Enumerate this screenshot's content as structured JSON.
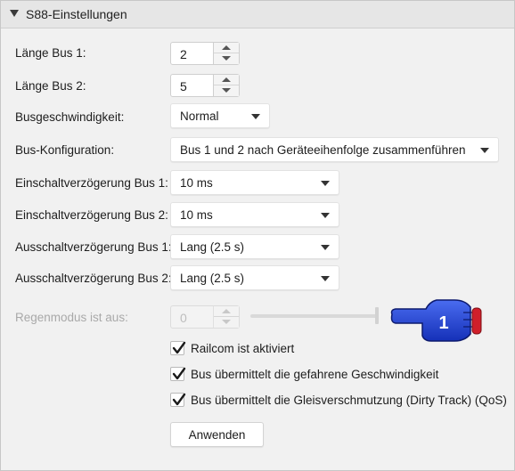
{
  "panel": {
    "title": "S88-Einstellungen"
  },
  "rows": {
    "laenge_bus1": {
      "label": "Länge Bus 1:",
      "value": "2"
    },
    "laenge_bus2": {
      "label": "Länge Bus 2:",
      "value": "5"
    },
    "busgeschwindigkeit": {
      "label": "Busgeschwindigkeit:",
      "value": "Normal"
    },
    "bus_konfiguration": {
      "label": "Bus-Konfiguration:",
      "value": "Bus 1 und 2 nach Geräteeihenfolge zusammenführen"
    },
    "einschalt_bus1": {
      "label": "Einschaltverzögerung Bus 1:",
      "value": "10 ms"
    },
    "einschalt_bus2": {
      "label": "Einschaltverzögerung Bus 2:",
      "value": "10 ms"
    },
    "ausschalt_bus1": {
      "label": "Ausschaltverzögerung Bus 1:",
      "value": "Lang (2.5 s)"
    },
    "ausschalt_bus2": {
      "label": "Ausschaltverzögerung Bus 2:",
      "value": "Lang (2.5 s)"
    },
    "regenmodus": {
      "label": "Regenmodus ist aus:",
      "value": "0",
      "slider_level": 1.0
    }
  },
  "checkboxes": [
    {
      "label": "Railcom ist aktiviert",
      "checked": true
    },
    {
      "label": "Bus übermittelt die gefahrene Geschwindigkeit",
      "checked": true
    },
    {
      "label": "Bus übermittelt die Gleisverschmutzung (Dirty Track) (QoS)",
      "checked": true
    }
  ],
  "apply_button": {
    "label": "Anwenden"
  },
  "callout": {
    "number": "1",
    "color": "#1f3fd6",
    "cuff_color": "#d01f2a"
  }
}
